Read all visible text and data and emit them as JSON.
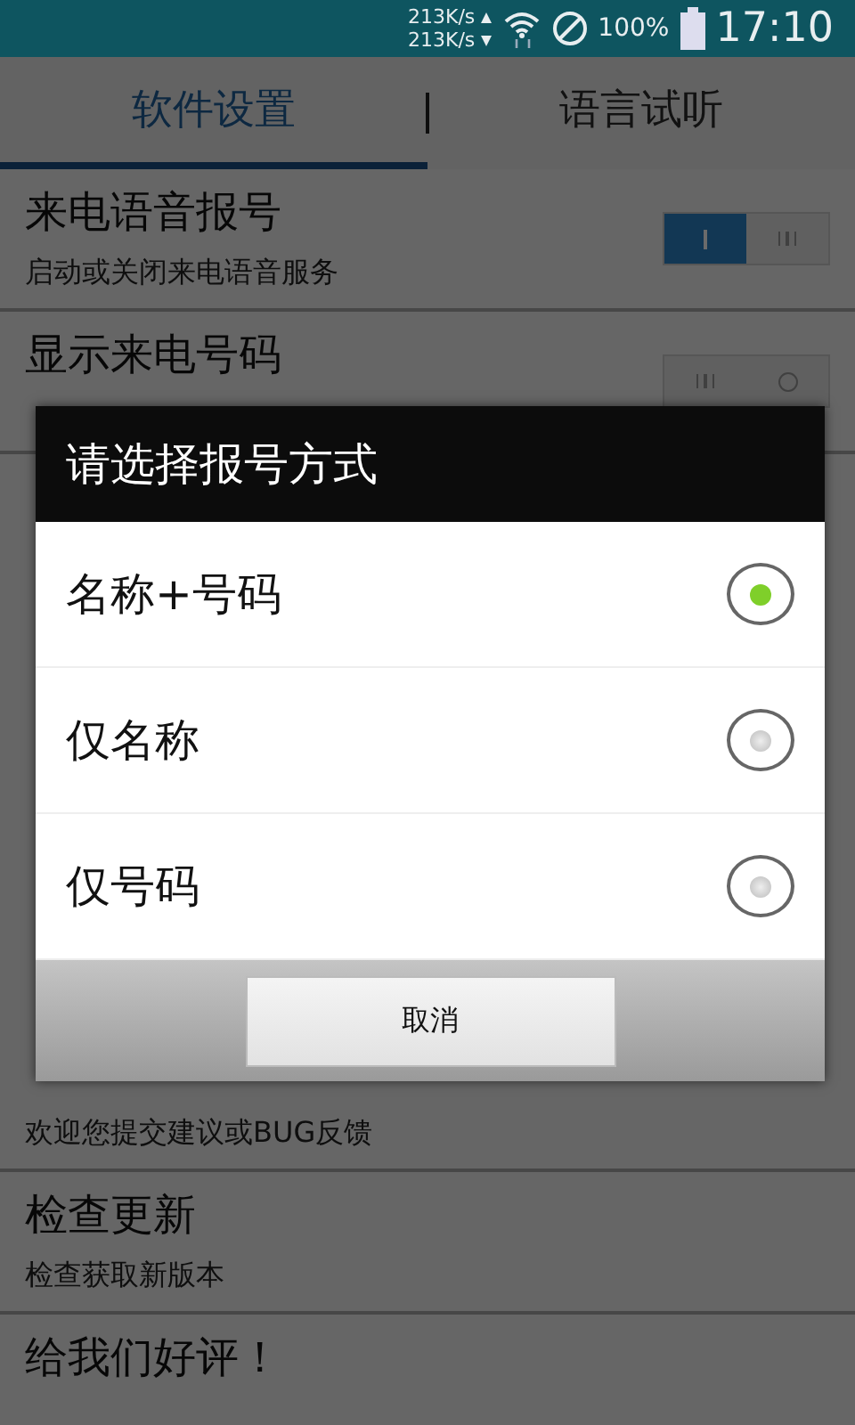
{
  "status_bar": {
    "upload_speed": "213K/s",
    "download_speed": "213K/s",
    "battery": "100%",
    "time": "17:10"
  },
  "tabs": [
    {
      "label": "软件设置",
      "selected": true
    },
    {
      "label": "语言试听",
      "selected": false
    }
  ],
  "settings_top": [
    {
      "title": "来电语音报号",
      "subtitle": "启动或关闭来电语音服务",
      "on": true
    },
    {
      "title": "显示来电号码",
      "on": false
    }
  ],
  "settings_bottom": [
    {
      "subtitle": "欢迎您提交建议或BUG反馈"
    },
    {
      "title": "检查更新",
      "subtitle": "检查获取新版本"
    },
    {
      "title": "给我们好评！"
    }
  ],
  "dialog": {
    "title": "请选择报号方式",
    "options": [
      {
        "label": "名称+号码",
        "selected": true
      },
      {
        "label": "仅名称",
        "selected": false
      },
      {
        "label": "仅号码",
        "selected": false
      }
    ],
    "cancel_button": "取消"
  }
}
